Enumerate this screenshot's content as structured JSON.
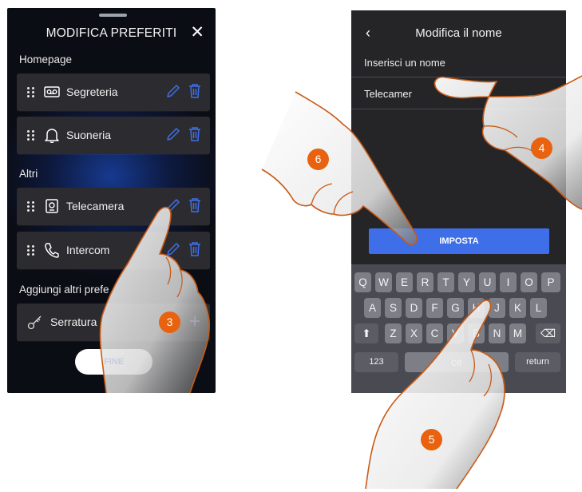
{
  "left_panel": {
    "title": "MODIFICA PREFERITI",
    "close_icon": "close-icon",
    "sections": {
      "homepage": "Homepage",
      "altri": "Altri",
      "aggiungi": "Aggiungi altri prefe"
    },
    "items": [
      {
        "label": "Segreteria",
        "icon": "voicemail-icon"
      },
      {
        "label": "Suoneria",
        "icon": "bell-icon"
      },
      {
        "label": "Telecamera",
        "icon": "camera-icon"
      },
      {
        "label": "Intercom",
        "icon": "phone-icon"
      },
      {
        "label": "Serratura",
        "icon": "key-icon"
      }
    ],
    "fine_button": "FINE",
    "accent_color": "#3f6fe8"
  },
  "right_panel": {
    "back_icon": "back-arrow-icon",
    "title": "Modifica il nome",
    "field_label": "Inserisci un nome",
    "field_value": "Telecamera 01",
    "field_value_visible": "Telecamer",
    "imposta_button": "IMPOSTA",
    "keyboard": {
      "row1": [
        "Q",
        "W",
        "E",
        "R",
        "T",
        "Y",
        "U",
        "I",
        "O",
        "P"
      ],
      "row2": [
        "A",
        "S",
        "D",
        "F",
        "G",
        "H",
        "J",
        "K",
        "L"
      ],
      "row3": [
        "Z",
        "X",
        "C",
        "V",
        "B",
        "N",
        "M"
      ],
      "numbers_key": "123",
      "space_key": "ce",
      "return_key": "return"
    }
  },
  "steps": [
    "3",
    "4",
    "5",
    "6"
  ],
  "badge_color": "#e8620f"
}
